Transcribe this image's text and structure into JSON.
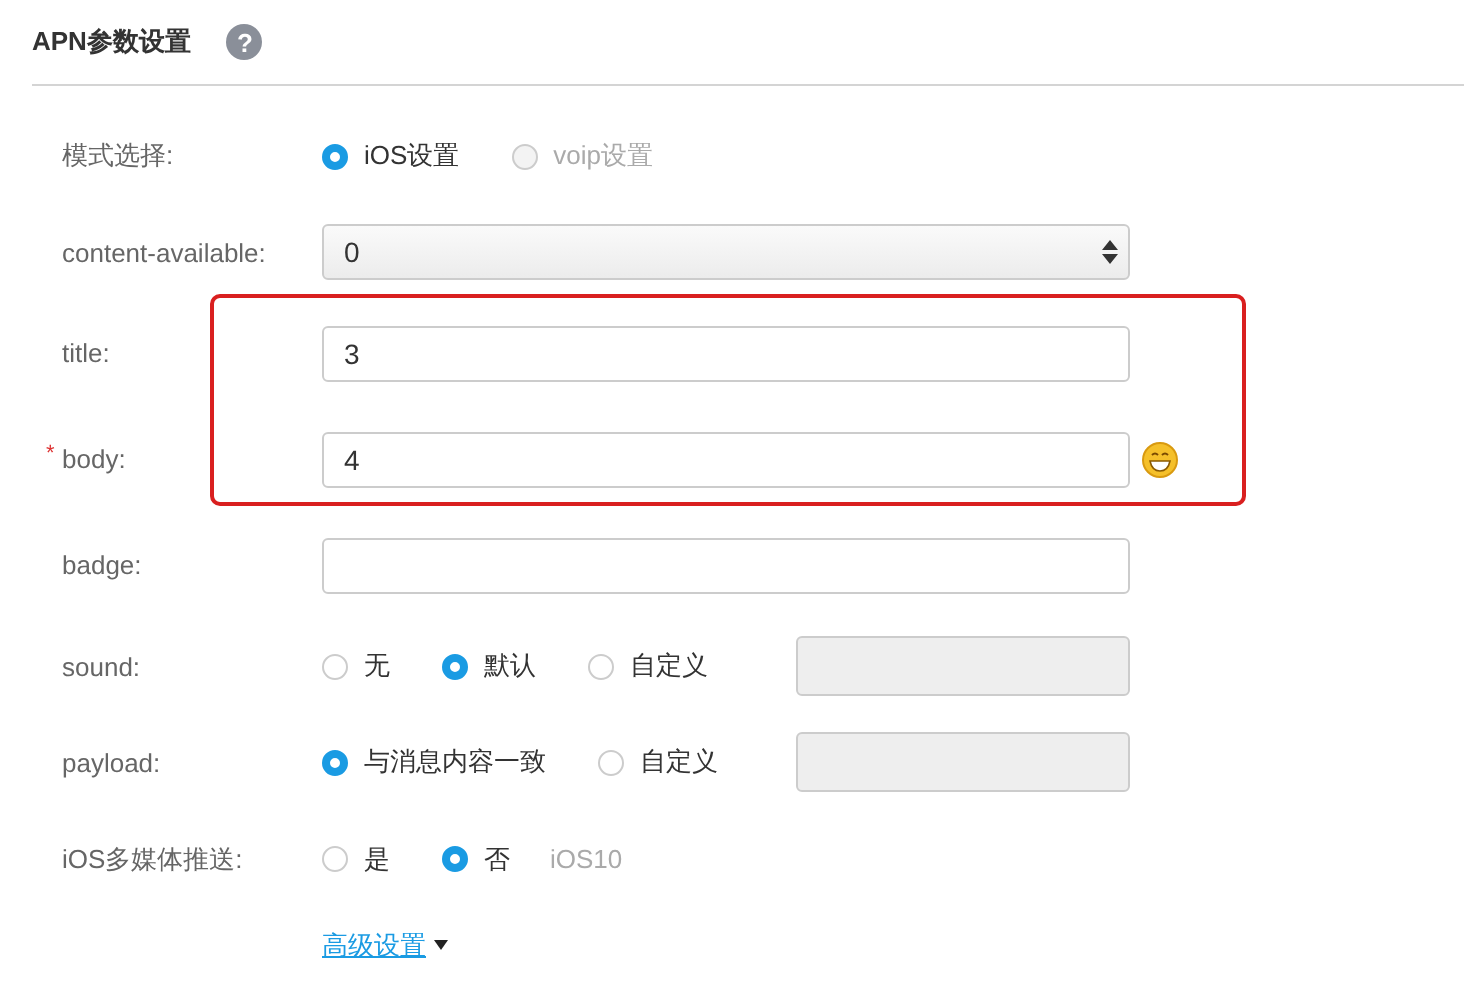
{
  "header": {
    "title": "APN参数设置",
    "help": "?"
  },
  "rows": [
    {
      "kind": "radios",
      "label": "模式选择:",
      "options": [
        {
          "label": "iOS设置",
          "selected": true,
          "disabled": false
        },
        {
          "label": "voip设置",
          "selected": false,
          "disabled": true
        }
      ]
    },
    {
      "kind": "select",
      "label": "content-available:",
      "value": "0"
    },
    {
      "kind": "text",
      "label": "title:",
      "value": "3",
      "emoji": false,
      "highlighted": true
    },
    {
      "kind": "text",
      "label": "body:",
      "required_mark": "*",
      "value": "4",
      "emoji": true,
      "highlighted": true
    },
    {
      "kind": "text",
      "label": "badge:",
      "value": "",
      "emoji": false,
      "highlighted": false
    },
    {
      "kind": "radios",
      "label": "sound:",
      "options": [
        {
          "label": "无",
          "selected": false,
          "disabled": false
        },
        {
          "label": "默认",
          "selected": true,
          "disabled": false
        },
        {
          "label": "自定义",
          "selected": false,
          "disabled": false
        }
      ],
      "custom_input": {
        "disabled": true
      }
    },
    {
      "kind": "radios",
      "label": "payload:",
      "options": [
        {
          "label": "与消息内容一致",
          "selected": true,
          "disabled": false
        },
        {
          "label": "自定义",
          "selected": false,
          "disabled": false
        }
      ],
      "custom_input": {
        "disabled": true
      }
    },
    {
      "kind": "radios",
      "label": "iOS多媒体推送:",
      "options": [
        {
          "label": "是",
          "selected": false,
          "disabled": false
        },
        {
          "label": "否",
          "selected": true,
          "disabled": false
        }
      ],
      "note": "iOS10"
    },
    {
      "kind": "link",
      "label": "高级设置",
      "expanded": false
    }
  ]
}
